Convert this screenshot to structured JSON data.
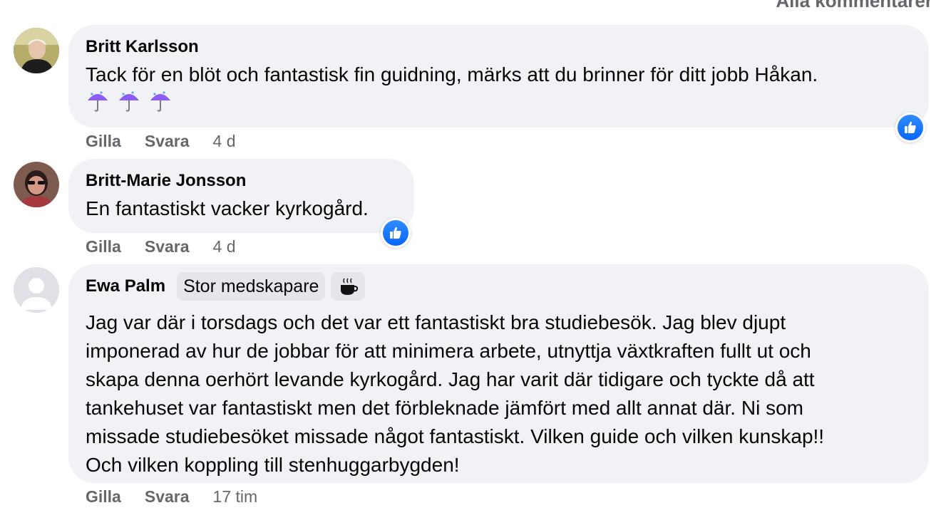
{
  "header": {
    "all_comments_label": "Alla kommentarer"
  },
  "comments": [
    {
      "author": "Britt Karlsson",
      "text": "Tack för en blöt och fantastisk fin guidning, märks att du brinner för ditt jobb Håkan.",
      "emojis": [
        "umbrella-rain-icon",
        "umbrella-rain-icon",
        "umbrella-rain-icon"
      ],
      "like_label": "Gilla",
      "reply_label": "Svara",
      "time": "4 d",
      "reaction": "like-icon"
    },
    {
      "author": "Britt-Marie Jonsson",
      "text": "En fantastiskt vacker kyrkogård.",
      "like_label": "Gilla",
      "reply_label": "Svara",
      "time": "4 d",
      "reaction": "like-icon"
    },
    {
      "author": "Ewa Palm",
      "badge": "Stor medskapare",
      "badge_icon": "hot-beverage-icon",
      "lines": [
        "Jag var där i torsdags och det var ett fantastiskt bra studiebesök. Jag blev djupt",
        "imponerad av hur de jobbar för att minimera arbete, utnyttja växtkraften fullt ut och",
        "skapa denna oerhört levande kyrkogård. Jag har varit där tidigare och tyckte då att",
        "tankehuset var fantastiskt men det förbleknade jämfört med allt annat där. Ni som",
        "missade studiebesöket missade något fantastiskt. Vilken guide och vilken kunskap!!",
        "Och vilken koppling till stenhuggarbygden!"
      ],
      "like_label": "Gilla",
      "reply_label": "Svara",
      "time": "17 tim"
    }
  ],
  "colors": {
    "bubble": "#f0f2f5",
    "secondary_text": "#65676b",
    "like_blue": "#0866ff"
  }
}
